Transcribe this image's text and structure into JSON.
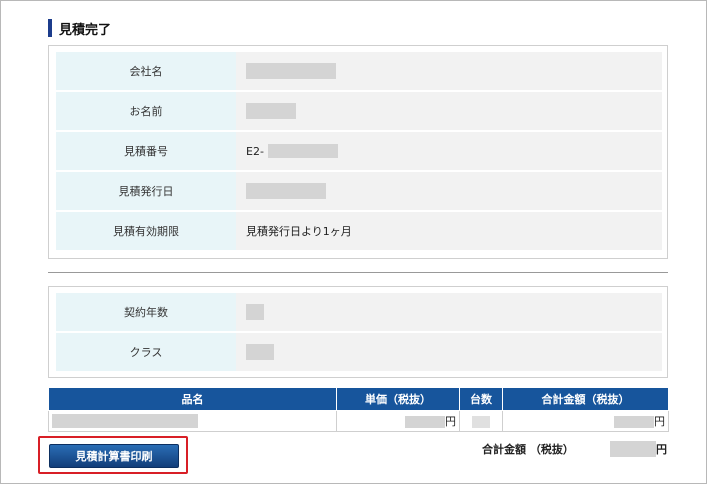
{
  "heading": {
    "title": "見積完了"
  },
  "info": {
    "rows": [
      {
        "label": "会社名",
        "value": ""
      },
      {
        "label": "お名前",
        "value": ""
      },
      {
        "label": "見積番号",
        "value": "E2-"
      },
      {
        "label": "見積発行日",
        "value": ""
      },
      {
        "label": "見積有効期限",
        "value": "見積発行日より1ヶ月"
      }
    ]
  },
  "contract": {
    "rows": [
      {
        "label": "契約年数",
        "value": ""
      },
      {
        "label": "クラス",
        "value": ""
      }
    ]
  },
  "table": {
    "headers": [
      "品名",
      "単価（税抜）",
      "台数",
      "合計金額（税抜）"
    ],
    "row": {
      "yen_unit": "円",
      "yen_total": "円"
    }
  },
  "summary": {
    "label": "合計金額 （税抜）",
    "currency": "円"
  },
  "actions": {
    "print_label": "見積計算書印刷"
  },
  "colors": {
    "header_bg": "#17559c",
    "label_bg": "#e8f5f8",
    "accent_red": "#e0001a",
    "highlight_border": "#d81f26"
  }
}
